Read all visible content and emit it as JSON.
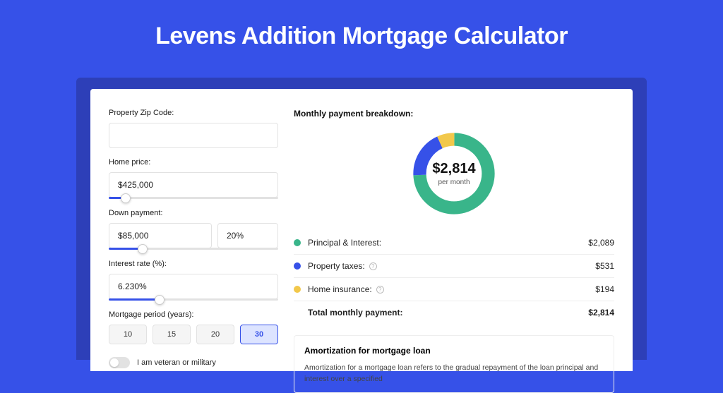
{
  "page_title": "Levens Addition Mortgage Calculator",
  "form": {
    "zip": {
      "label": "Property Zip Code:",
      "value": ""
    },
    "home_price": {
      "label": "Home price:",
      "value": "$425,000",
      "slider_fill_pct": 10
    },
    "down_payment": {
      "label": "Down payment:",
      "value": "$85,000",
      "percent": "20%",
      "slider_fill_pct": 20
    },
    "interest_rate": {
      "label": "Interest rate (%):",
      "value": "6.230%",
      "slider_fill_pct": 30
    },
    "mortgage_period": {
      "label": "Mortgage period (years):",
      "options": [
        "10",
        "15",
        "20",
        "30"
      ],
      "selected": "30"
    },
    "veteran": {
      "label": "I am veteran or military",
      "checked": false
    }
  },
  "breakdown": {
    "title": "Monthly payment breakdown:",
    "center_amount": "$2,814",
    "center_sub": "per month",
    "items": [
      {
        "name": "Principal & Interest:",
        "value": "$2,089",
        "numeric": 2089,
        "color": "#39B58A",
        "info": false
      },
      {
        "name": "Property taxes:",
        "value": "$531",
        "numeric": 531,
        "color": "#3651E8",
        "info": true
      },
      {
        "name": "Home insurance:",
        "value": "$194",
        "numeric": 194,
        "color": "#F2C84B",
        "info": true
      }
    ],
    "total": {
      "name": "Total monthly payment:",
      "value": "$2,814"
    }
  },
  "amortization": {
    "title": "Amortization for mortgage loan",
    "text": "Amortization for a mortgage loan refers to the gradual repayment of the loan principal and interest over a specified"
  },
  "chart_data": {
    "type": "pie",
    "title": "Monthly payment breakdown",
    "series": [
      {
        "name": "Principal & Interest",
        "value": 2089,
        "color": "#39B58A"
      },
      {
        "name": "Property taxes",
        "value": 531,
        "color": "#3651E8"
      },
      {
        "name": "Home insurance",
        "value": 194,
        "color": "#F2C84B"
      }
    ],
    "total": 2814,
    "center_label": "$2,814 per month"
  }
}
